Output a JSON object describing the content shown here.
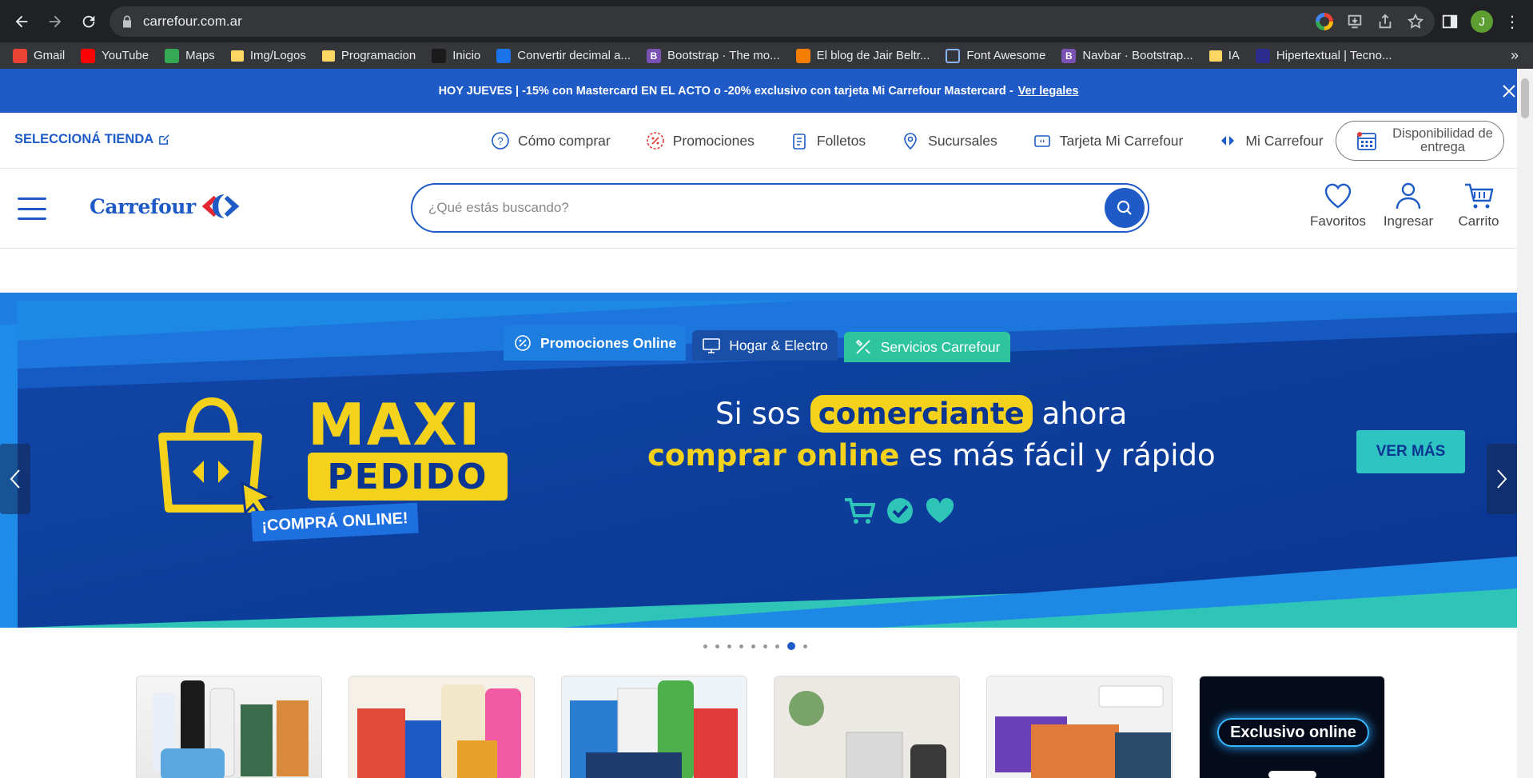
{
  "browser": {
    "url": "carrefour.com.ar",
    "profile_initial": "J",
    "bookmarks": [
      {
        "label": "Gmail",
        "icon": "gmail-icon",
        "color": "#ea4335"
      },
      {
        "label": "YouTube",
        "icon": "youtube-icon",
        "color": "#ff0000"
      },
      {
        "label": "Maps",
        "icon": "maps-icon",
        "color": "#34a853"
      },
      {
        "label": "Img/Logos",
        "icon": "folder-icon",
        "color": "#fdd663"
      },
      {
        "label": "Programacion",
        "icon": "folder-icon",
        "color": "#fdd663"
      },
      {
        "label": "Inicio",
        "icon": "site-icon",
        "color": "#1a1a1a"
      },
      {
        "label": "Convertir decimal a...",
        "icon": "gear-icon",
        "color": "#1a73e8"
      },
      {
        "label": "Bootstrap · The mo...",
        "icon": "bootstrap-icon",
        "color": "#7952b3"
      },
      {
        "label": "El blog de Jair Beltr...",
        "icon": "blogger-icon",
        "color": "#f57d00"
      },
      {
        "label": "Font Awesome",
        "icon": "flag-icon",
        "color": "#35363a"
      },
      {
        "label": "Navbar · Bootstrap...",
        "icon": "bootstrap-icon",
        "color": "#7952b3"
      },
      {
        "label": "IA",
        "icon": "folder-icon",
        "color": "#fdd663"
      },
      {
        "label": "Hipertextual | Tecno...",
        "icon": "site-icon",
        "color": "#2b2b8c"
      }
    ]
  },
  "promo_bar": {
    "text": "HOY JUEVES | -15% con Mastercard EN EL ACTO o -20% exclusivo con tarjeta Mi Carrefour Mastercard -",
    "link": "Ver legales"
  },
  "utility": {
    "store_select": "SELECCIONÁ TIENDA",
    "links": [
      "Cómo comprar",
      "Promociones",
      "Folletos",
      "Sucursales",
      "Tarjeta Mi Carrefour",
      "Mi Carrefour"
    ],
    "availability": "Disponibilidad de entrega"
  },
  "header": {
    "logo": "Carrefour",
    "search_placeholder": "¿Qué estás buscando?",
    "account": [
      "Favoritos",
      "Ingresar",
      "Carrito"
    ]
  },
  "category_tabs": [
    "Promociones Online",
    "Hogar & Electro",
    "Servicios Carrefour"
  ],
  "hero": {
    "brand_line1": "MAXI",
    "brand_line2": "PEDIDO",
    "badge": "¡COMPRÁ ONLINE!",
    "headline_pre": "Si sos",
    "headline_highlight": "comerciante",
    "headline_post": "ahora",
    "sub_highlight": "comprar online",
    "sub_rest": "es más fácil y rápido",
    "cta": "VER MÁS"
  },
  "carousel": {
    "total_slides": 9,
    "active_index": 7
  },
  "cards": [
    {
      "name": "personal-care"
    },
    {
      "name": "groceries"
    },
    {
      "name": "pantry"
    },
    {
      "name": "home-heating"
    },
    {
      "name": "electronics"
    },
    {
      "name": "exclusive-online",
      "label": "Exclusivo online"
    }
  ],
  "colors": {
    "brand_blue": "#1e5bc6",
    "hero_navy": "#0a3a9a",
    "yellow": "#f4d21c",
    "teal": "#2ec4c4"
  }
}
